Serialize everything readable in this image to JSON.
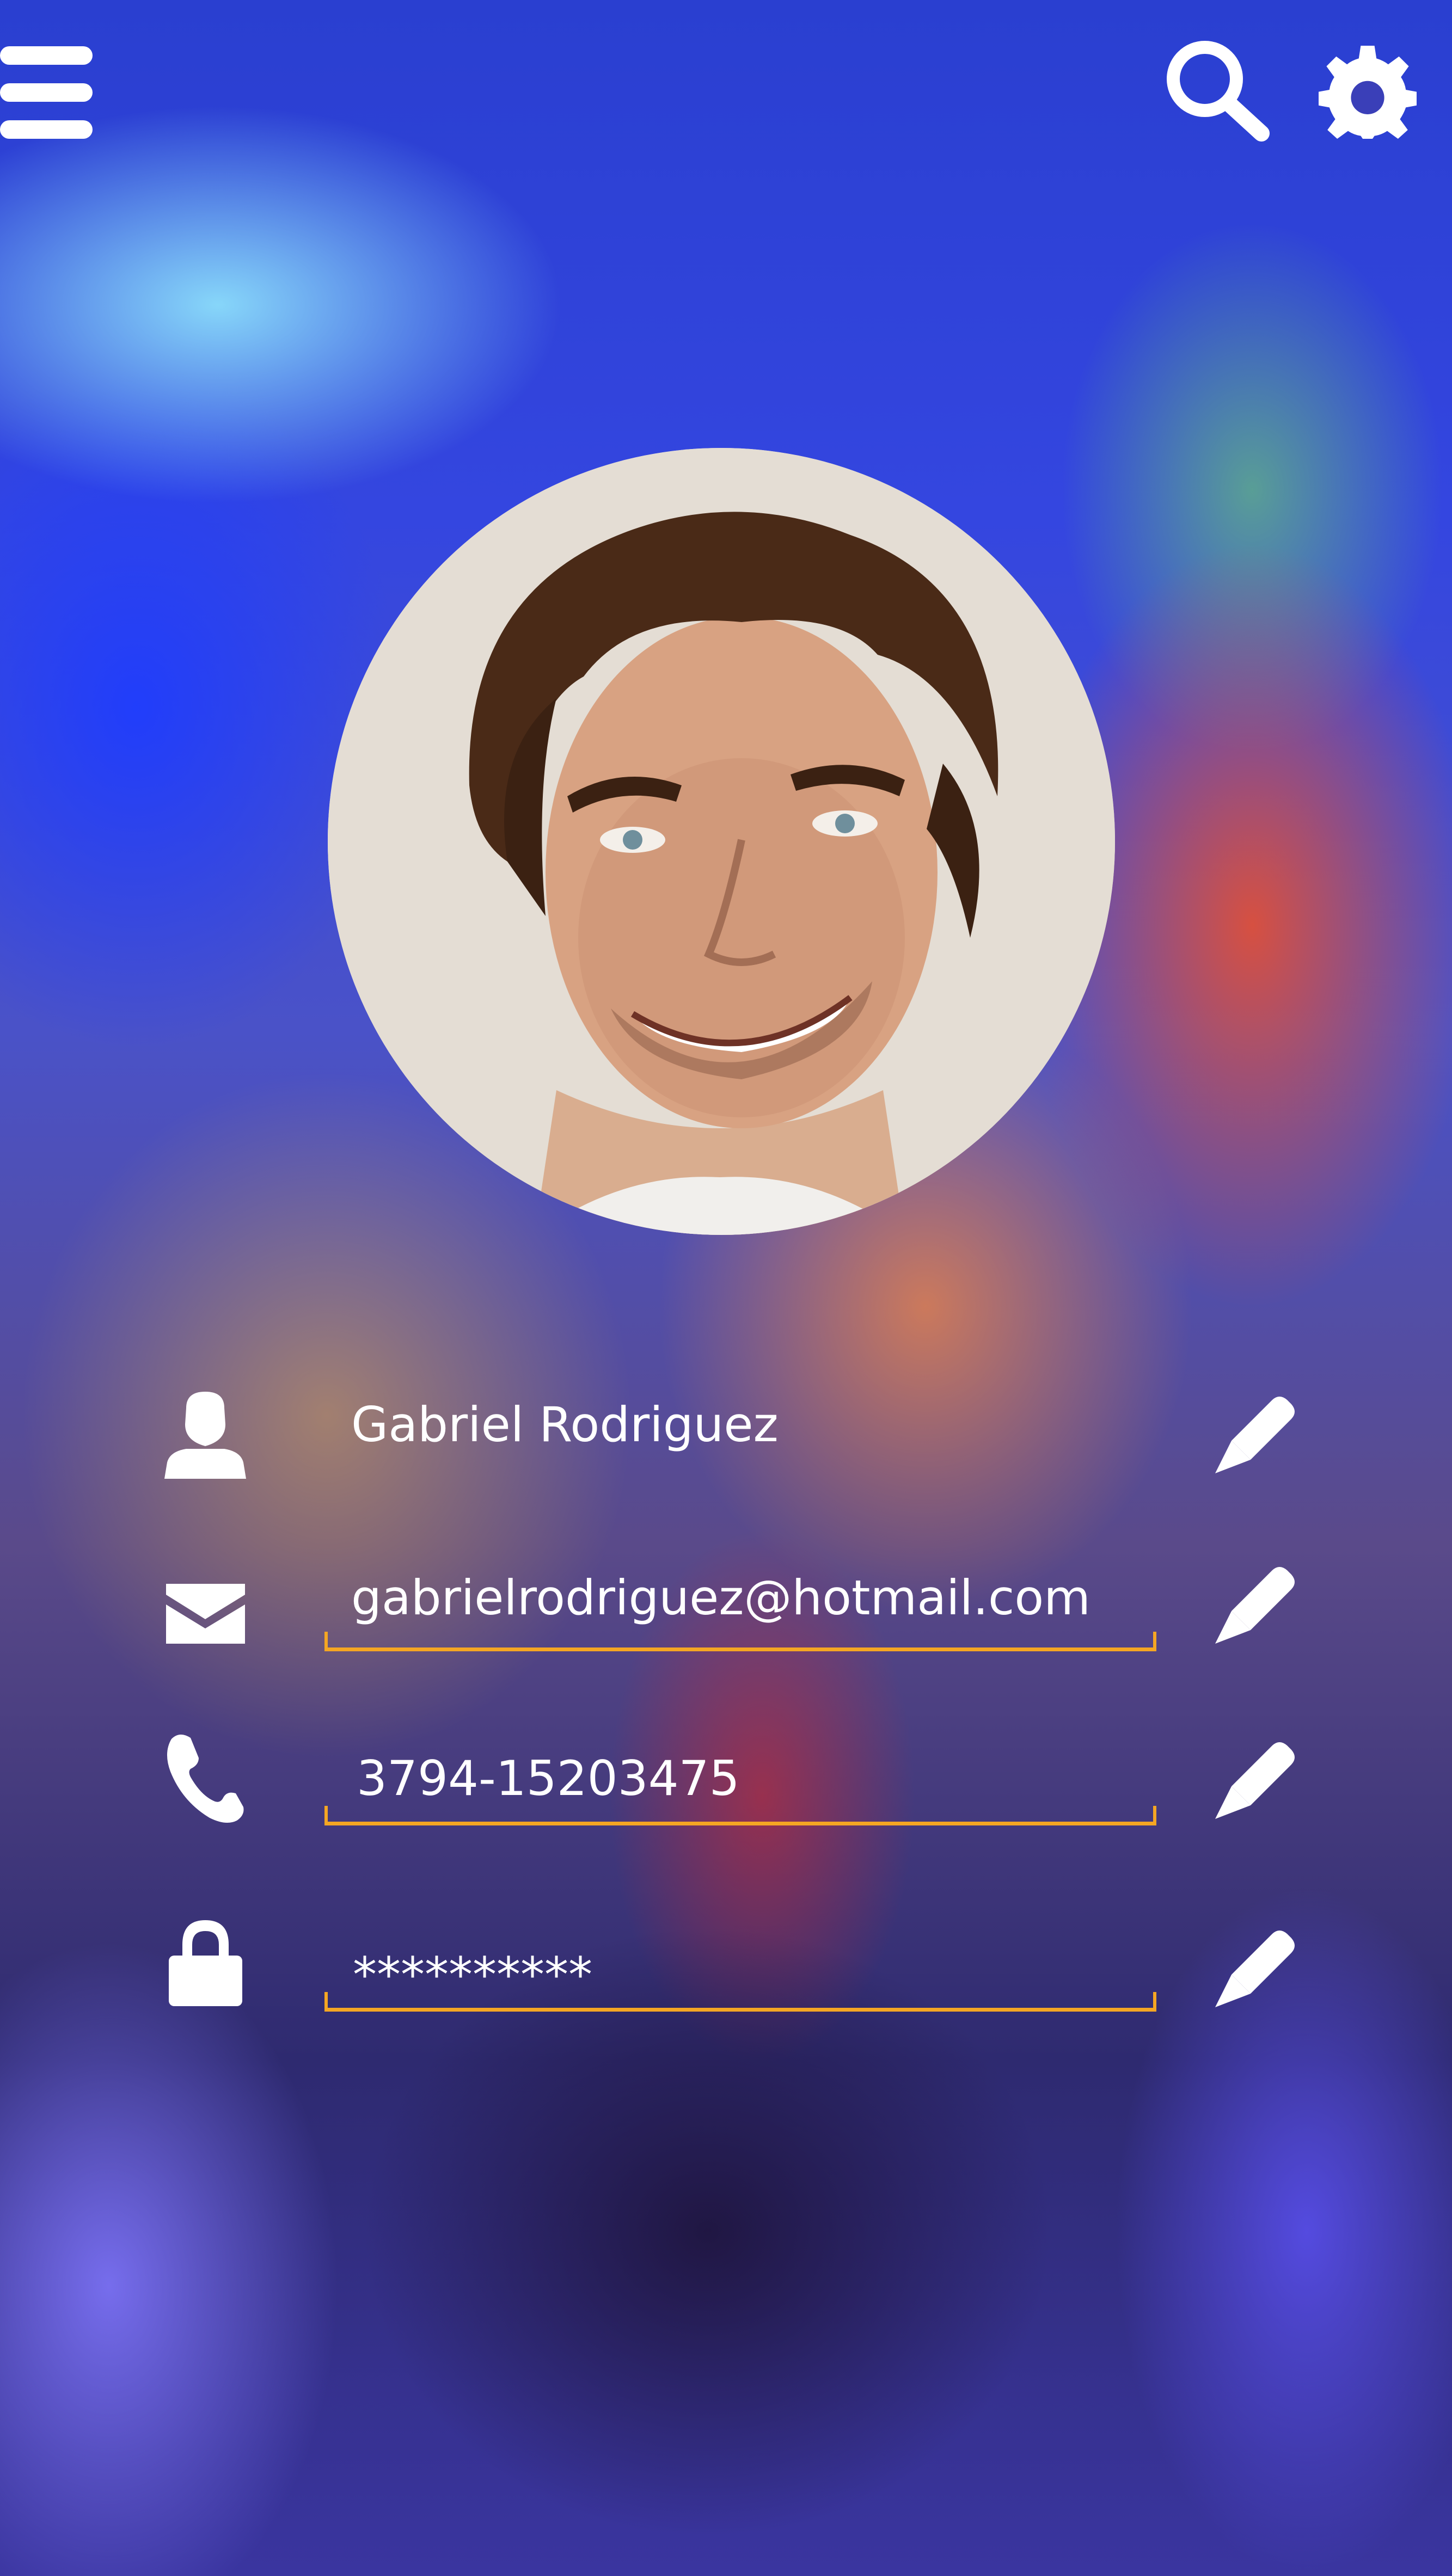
{
  "header": {
    "menu_icon": "hamburger-menu-icon",
    "search_icon": "search-icon",
    "settings_icon": "gear-icon"
  },
  "profile": {
    "avatar": "profile-photo"
  },
  "fields": [
    {
      "icon": "person-icon",
      "value": "Gabriel Rodriguez",
      "edit_icon": "pencil-icon"
    },
    {
      "icon": "envelope-icon",
      "value": "gabrielrodriguez@hotmail.com",
      "edit_icon": "pencil-icon"
    },
    {
      "icon": "phone-icon",
      "value": "3794-15203475",
      "edit_icon": "pencil-icon"
    },
    {
      "icon": "lock-icon",
      "value": "**********",
      "edit_icon": "pencil-icon"
    }
  ],
  "colors": {
    "accent": "#f5a623",
    "text": "#ffffff"
  }
}
